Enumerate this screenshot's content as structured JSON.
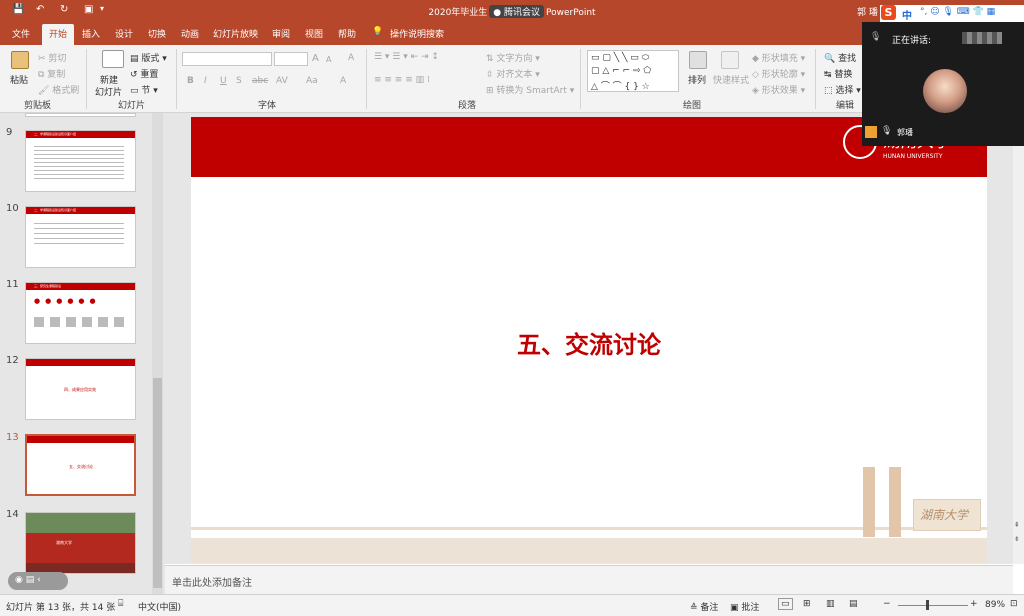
{
  "window": {
    "title_left": "2020年毕业生",
    "meeting_badge": "腾讯会议",
    "title_right": "PowerPoint",
    "user": "郭",
    "user_suffix": "璠"
  },
  "quick_access": [
    "save-icon",
    "undo-icon",
    "redo-icon",
    "start-slideshow-icon"
  ],
  "tabs": [
    "文件",
    "开始",
    "插入",
    "设计",
    "切换",
    "动画",
    "幻灯片放映",
    "审阅",
    "视图",
    "帮助"
  ],
  "active_tab": "开始",
  "tell_me": "操作说明搜索",
  "ribbon": {
    "clipboard": {
      "label": "剪贴板",
      "paste": "粘贴",
      "cut": "剪切",
      "copy": "复制",
      "format_painter": "格式刷"
    },
    "slides": {
      "label": "幻灯片",
      "new_slide": "新建",
      "new_slide_2": "幻灯片",
      "layout": "版式",
      "reset": "重置",
      "section": "节"
    },
    "font": {
      "label": "字体",
      "font_name": "",
      "font_size": "",
      "grow": "A",
      "shrink": "A",
      "clear": "A",
      "bold": "B",
      "italic": "I",
      "underline": "U",
      "shadow": "S",
      "strike": "abc",
      "spacing": "AV",
      "case": "Aa",
      "color": "A"
    },
    "paragraph": {
      "label": "段落",
      "text_direction": "文字方向",
      "align_text": "对齐文本",
      "smartart": "转换为 SmartArt"
    },
    "drawing": {
      "label": "绘图",
      "arrange": "排列",
      "quick_styles": "快速样式",
      "fill": "形状填充",
      "outline": "形状轮廓",
      "effects": "形状效果"
    },
    "editing": {
      "label": "编辑",
      "find": "查找",
      "replace": "替换",
      "select": "选择"
    }
  },
  "meeting": {
    "speaking_label": "正在讲话:",
    "speaker_name": "郭璠",
    "ime_label": "中"
  },
  "thumbnails": [
    {
      "num": "9",
      "title": "二、学课程建设建设知识面介绍"
    },
    {
      "num": "10",
      "title": "二、学课程建设建设知识面介绍"
    },
    {
      "num": "11",
      "title": "三、研究生课程建设"
    },
    {
      "num": "12",
      "title": "四、成果应用实效"
    },
    {
      "num": "13",
      "title": "五、交流讨论"
    },
    {
      "num": "14",
      "title": "湖南大学"
    }
  ],
  "selected_slide": "13",
  "slide": {
    "title": "五、交流讨论",
    "logo_text": "HUNAN UNIVERSITY",
    "logo_script": "湖南大学",
    "footer_script": "湖南大学"
  },
  "notes_placeholder": "单击此处添加备注",
  "status": {
    "slide_info": "幻灯片 第 13 张，共 14 张",
    "language": "中文(中国)",
    "notes": "备注",
    "comments": "批注",
    "zoom": "89%"
  },
  "colors": {
    "accent": "#b7472a",
    "slide_red": "#c00000"
  }
}
